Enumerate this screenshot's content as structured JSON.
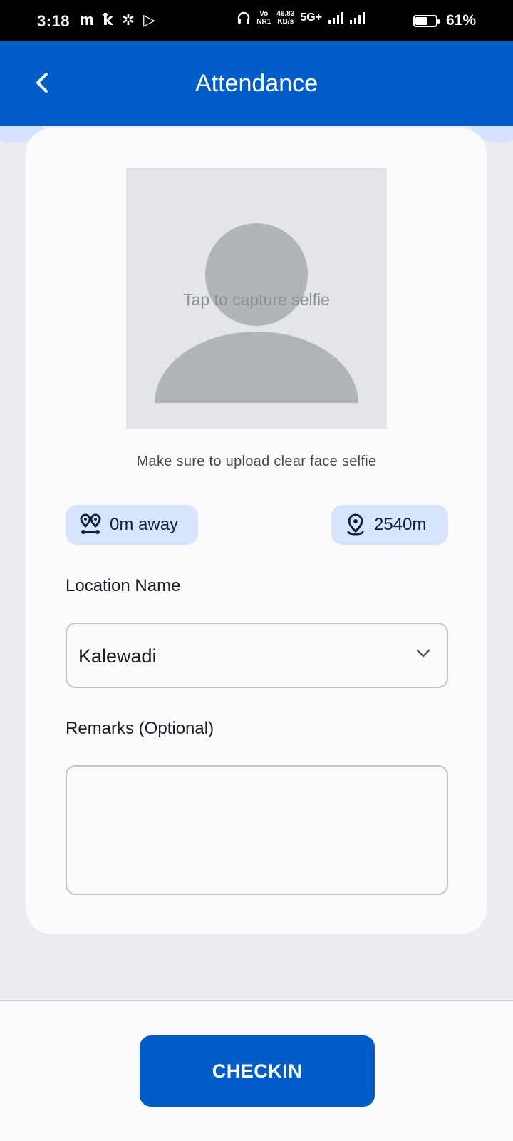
{
  "status_bar": {
    "time": "3:18",
    "left_icons": [
      "m",
      "ꝁ",
      "✲",
      "▷"
    ],
    "vo": "Vo",
    "nr": "NR1",
    "speed_value": "46.83",
    "speed_unit": "KB/s",
    "network": "5G+",
    "battery_percent": "61%",
    "battery_level": 0.61
  },
  "app_bar": {
    "title": "Attendance",
    "back_icon": "chevron-left-icon"
  },
  "selfie": {
    "hint": "Tap to capture selfie",
    "placeholder_icon": "person-silhouette-icon"
  },
  "upload_note": "Make sure to upload clear face selfie",
  "chips": {
    "distance": {
      "icon": "route-pins-icon",
      "label": "0m away"
    },
    "radius": {
      "icon": "location-pin-icon",
      "label": "2540m"
    }
  },
  "form": {
    "location_label": "Location Name",
    "location_value": "Kalewadi",
    "remarks_label": "Remarks (Optional)",
    "remarks_value": ""
  },
  "actions": {
    "checkin_label": "CHECKIN"
  },
  "colors": {
    "primary": "#005dc8",
    "chip_bg": "#d8e4fb",
    "background": "#ecedf2",
    "card": "#fbfafd"
  }
}
